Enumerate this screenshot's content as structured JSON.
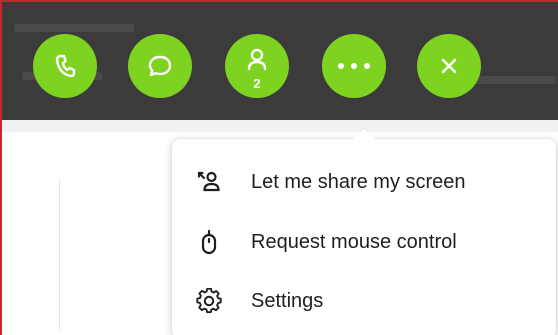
{
  "toolbar": {
    "buttons": [
      {
        "icon": "phone-icon"
      },
      {
        "icon": "chat-bubble-icon"
      },
      {
        "icon": "person-icon",
        "badge": "2"
      },
      {
        "icon": "more-horizontal-icon"
      },
      {
        "icon": "close-icon"
      }
    ],
    "accent_color": "#7dd320",
    "background_color": "#3b3b3b"
  },
  "menu": {
    "items": [
      {
        "label": "Let me share my screen",
        "icon": "share-screen-icon"
      },
      {
        "label": "Request mouse control",
        "icon": "mouse-icon"
      },
      {
        "label": "Settings",
        "icon": "gear-icon"
      }
    ]
  }
}
